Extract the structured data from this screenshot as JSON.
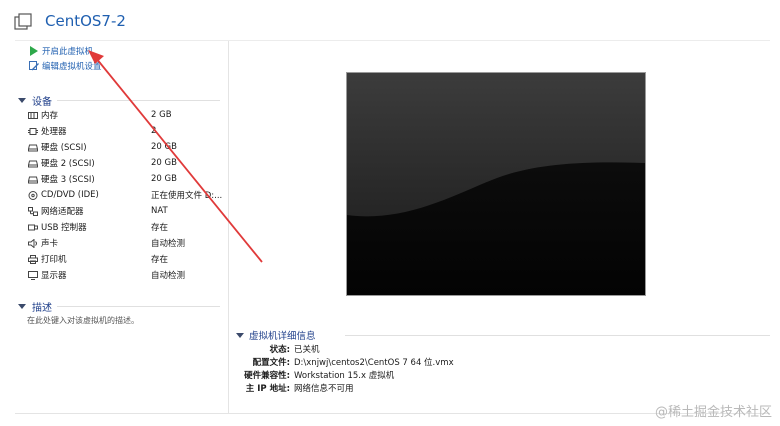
{
  "vm": {
    "title": "CentOS7-2"
  },
  "actions": {
    "power_on": "开启此虚拟机",
    "edit_settings": "编辑虚拟机设置"
  },
  "devices": {
    "header": "设备",
    "items": [
      {
        "name": "内存",
        "value": "2 GB",
        "icon": "memory-icon"
      },
      {
        "name": "处理器",
        "value": "2",
        "icon": "cpu-icon"
      },
      {
        "name": "硬盘 (SCSI)",
        "value": "20 GB",
        "icon": "hard-disk-icon"
      },
      {
        "name": "硬盘 2 (SCSI)",
        "value": "20 GB",
        "icon": "hard-disk-icon"
      },
      {
        "name": "硬盘 3 (SCSI)",
        "value": "20 GB",
        "icon": "hard-disk-icon"
      },
      {
        "name": "CD/DVD (IDE)",
        "value": "正在使用文件 D:...",
        "icon": "cd-dvd-icon"
      },
      {
        "name": "网络适配器",
        "value": "NAT",
        "icon": "network-adapter-icon"
      },
      {
        "name": "USB 控制器",
        "value": "存在",
        "icon": "usb-icon"
      },
      {
        "name": "声卡",
        "value": "自动检测",
        "icon": "sound-card-icon"
      },
      {
        "name": "打印机",
        "value": "存在",
        "icon": "printer-icon"
      },
      {
        "name": "显示器",
        "value": "自动检测",
        "icon": "display-icon"
      }
    ]
  },
  "description": {
    "header": "描述",
    "placeholder": "在此处键入对该虚拟机的描述。"
  },
  "details": {
    "header": "虚拟机详细信息",
    "rows": [
      {
        "key": "状态:",
        "value": "已关机"
      },
      {
        "key": "配置文件:",
        "value": "D:\\xnjwj\\centos2\\CentOS 7 64 位.vmx"
      },
      {
        "key": "硬件兼容性:",
        "value": "Workstation 15.x 虚拟机"
      },
      {
        "key": "主 IP 地址:",
        "value": "网络信息不可用"
      }
    ]
  },
  "watermark": "@稀土掘金技术社区",
  "colors": {
    "link": "#1f5fb0",
    "play_green": "#2ea84a",
    "annotation_arrow": "#e03a3a"
  }
}
